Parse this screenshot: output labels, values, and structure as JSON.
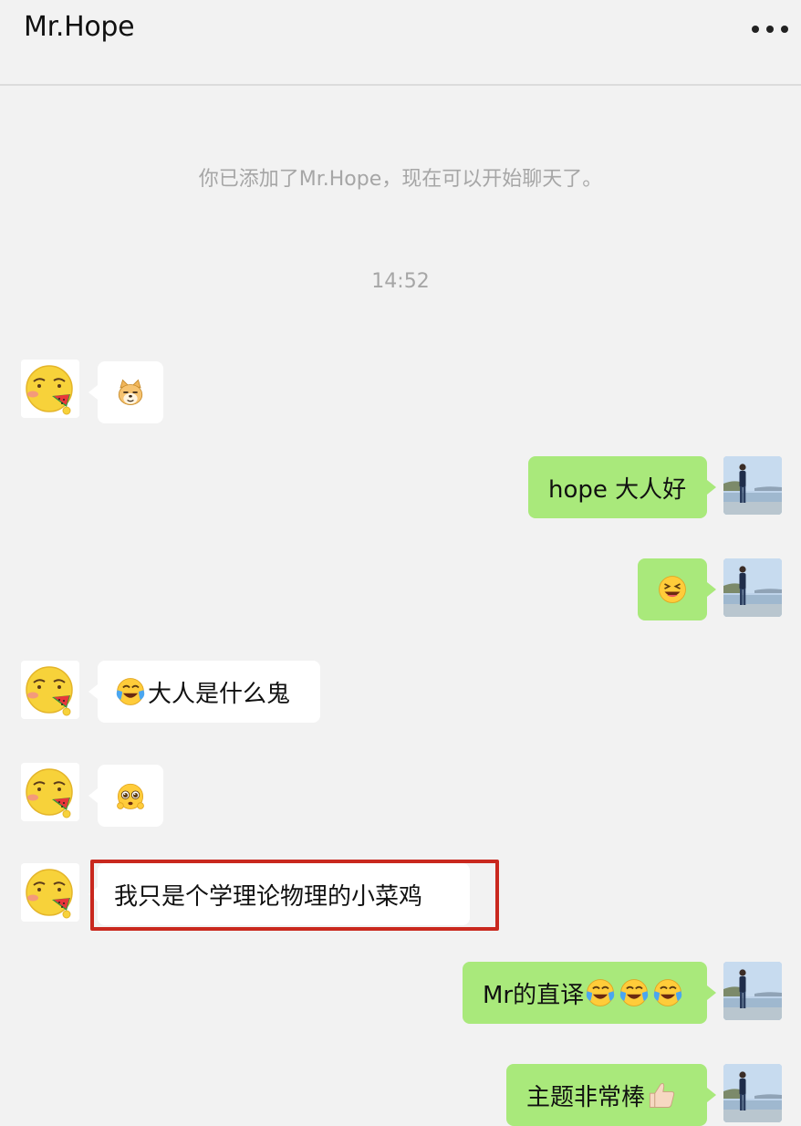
{
  "header": {
    "title": "Mr.Hope",
    "more_icon": "more-dots-icon"
  },
  "system": {
    "added_notice": "你已添加了Mr.Hope，现在可以开始聊天了。",
    "time": "14:52"
  },
  "messages": [
    {
      "side": "in",
      "text": "",
      "emoji": "doge-emoji"
    },
    {
      "side": "out",
      "text": "hope 大人好"
    },
    {
      "side": "out",
      "text": "",
      "emoji": "laughing-squint-emoji"
    },
    {
      "side": "in",
      "text": "大人是什么鬼",
      "prefix_emoji": "crying-laughing-emoji"
    },
    {
      "side": "in",
      "text": "",
      "emoji": "pleading-emoji"
    },
    {
      "side": "in",
      "text": "我只是个学理论物理的小菜鸡",
      "highlighted": true
    },
    {
      "side": "out",
      "text": "Mr的直译",
      "suffix_emoji": [
        "crying-laughing-emoji",
        "crying-laughing-emoji",
        "crying-laughing-emoji"
      ]
    },
    {
      "side": "out",
      "text": "主题非常棒",
      "suffix_emoji": [
        "thumbs-up-emoji"
      ]
    }
  ],
  "colors": {
    "background": "#f2f2f2",
    "incoming_bubble": "#ffffff",
    "outgoing_bubble": "#a9e97b",
    "highlight_border": "#c9281e",
    "system_text": "#a6a6a6"
  }
}
